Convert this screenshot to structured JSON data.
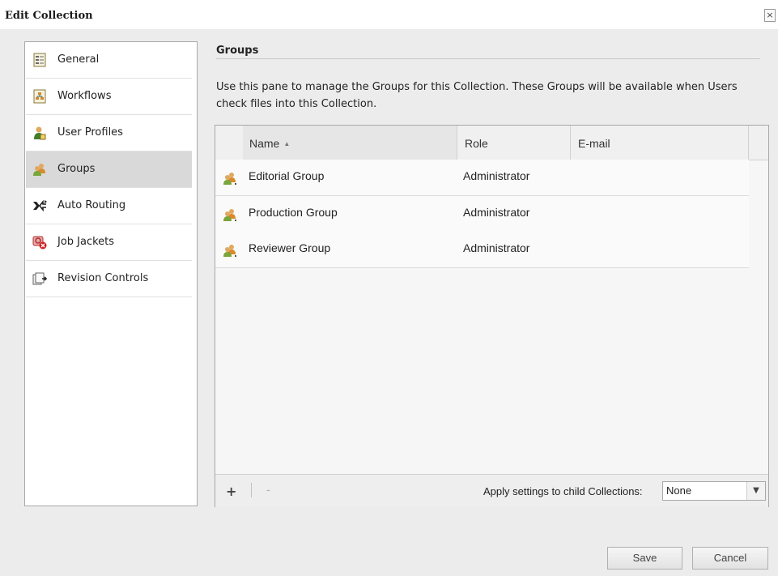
{
  "window": {
    "title": "Edit Collection",
    "close_label": "×"
  },
  "sidebar": {
    "items": [
      {
        "label": "General",
        "icon": "general-icon"
      },
      {
        "label": "Workflows",
        "icon": "workflows-icon"
      },
      {
        "label": "User Profiles",
        "icon": "user-profiles-icon"
      },
      {
        "label": "Groups",
        "icon": "groups-icon",
        "selected": true
      },
      {
        "label": "Auto Routing",
        "icon": "auto-routing-icon"
      },
      {
        "label": "Job Jackets",
        "icon": "job-jackets-icon"
      },
      {
        "label": "Revision Controls",
        "icon": "revision-controls-icon"
      }
    ]
  },
  "pane": {
    "title": "Groups",
    "description": "Use this pane to manage the Groups for this Collection. These Groups will be available when Users check files into this Collection."
  },
  "grid": {
    "columns": [
      {
        "label": "Name",
        "sorted": "ascending",
        "sort_glyph": "▲"
      },
      {
        "label": "Role"
      },
      {
        "label": "E-mail"
      }
    ],
    "rows": [
      {
        "name": "Editorial Group",
        "role": "Administrator",
        "email": ""
      },
      {
        "name": "Production Group",
        "role": "Administrator",
        "email": ""
      },
      {
        "name": "Reviewer Group",
        "role": "Administrator",
        "email": ""
      }
    ],
    "footer": {
      "add_label": "+",
      "remove_label": "-",
      "apply_label": "Apply settings to child Collections:",
      "apply_value": "None",
      "apply_arrow": "▼"
    }
  },
  "buttons": {
    "save": "Save",
    "cancel": "Cancel"
  },
  "colors": {
    "selected_bg": "#d9d9d9",
    "group_icon_green": "#7aa53a",
    "group_icon_orange": "#d98b2b"
  }
}
